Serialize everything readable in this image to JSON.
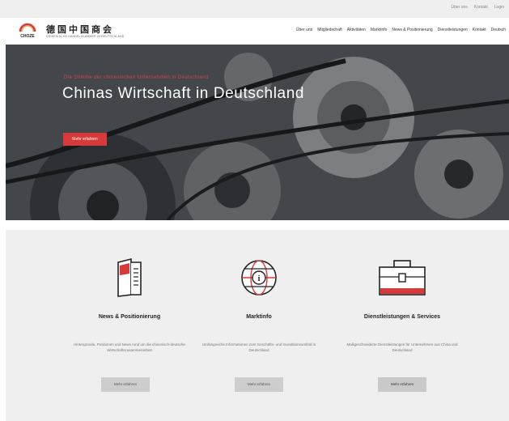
{
  "topbar": {
    "links": [
      "Über uns",
      "Kontakt",
      "Login"
    ]
  },
  "header": {
    "logo_text": "CHOZE",
    "logo_cn": "德国中国商会",
    "logo_sub": "CHINESISCHE HANDELSKAMMER IN DEUTSCHLAND",
    "nav": [
      "Über uns",
      "Mitgliedschaft",
      "Aktivitäten",
      "Marktinfo",
      "News & Positionierung",
      "Dienstleistungen",
      "Kontakt",
      "Deutsch"
    ]
  },
  "hero": {
    "kicker": "Die Stimme der chinesischen Unternehmen in Deutschland",
    "title": "Chinas Wirtschaft in Deutschland",
    "button": "Mehr erfahren"
  },
  "cards": [
    {
      "title": "News & Positionierung",
      "desc": "Hintergründe, Positionen und News rund um die chinesisch-deutsche Wirtschaftszusammenarbeit",
      "button": "Mehr erfahren",
      "icon": "document-icon"
    },
    {
      "title": "Marktinfo",
      "desc": "Umfangreiche Informationen zum Geschäfts- und Investitionsumfeld in Deutschland",
      "button": "Mehr erfahren",
      "icon": "globe-info-icon"
    },
    {
      "title": "Dienstleistungen & Services",
      "desc": "Maßgeschneiderte Dienstleistungen für Unternehmen aus China und Deutschland",
      "button": "Mehr erfahren",
      "icon": "briefcase-icon"
    }
  ],
  "colors": {
    "accent": "#d63a3a",
    "section_bg": "#efefef"
  }
}
